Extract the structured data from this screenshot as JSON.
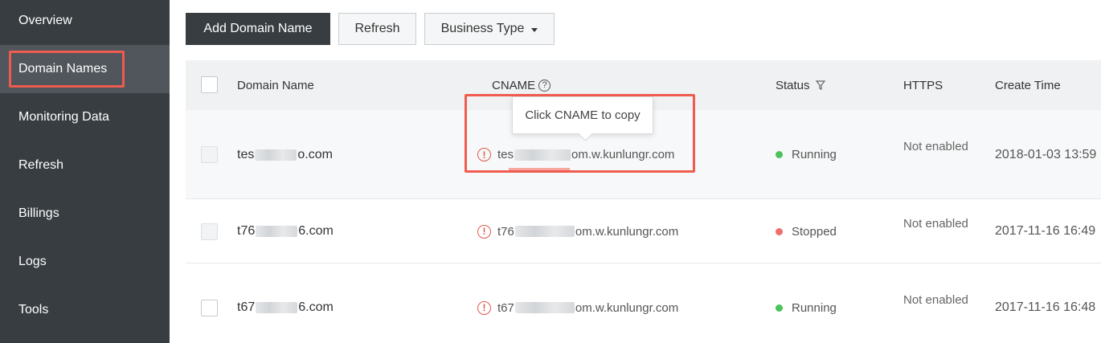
{
  "sidebar": {
    "items": [
      {
        "label": "Overview"
      },
      {
        "label": "Domain Names"
      },
      {
        "label": "Monitoring Data"
      },
      {
        "label": "Refresh"
      },
      {
        "label": "Billings"
      },
      {
        "label": "Logs"
      },
      {
        "label": "Tools"
      }
    ],
    "active": "Domain Names"
  },
  "toolbar": {
    "add_label": "Add Domain Name",
    "refresh_label": "Refresh",
    "business_type_label": "Business Type"
  },
  "table": {
    "headers": {
      "domain": "Domain Name",
      "cname": "CNAME",
      "status": "Status",
      "https": "HTTPS",
      "create_time": "Create Time"
    },
    "tooltip": "Click CNAME to copy",
    "rows": [
      {
        "domain_prefix": "tes",
        "domain_suffix": "o.com",
        "cname_prefix": "tes",
        "cname_suffix": "om.w.kunlungr.com",
        "status": "Running",
        "https": "Not enabled",
        "create_time": "2018-01-03 13:59"
      },
      {
        "domain_prefix": "t76",
        "domain_suffix": "6.com",
        "cname_prefix": "t76",
        "cname_suffix": "om.w.kunlungr.com",
        "status": "Stopped",
        "https": "Not enabled",
        "create_time": "2017-11-16 16:49"
      },
      {
        "domain_prefix": "t67",
        "domain_suffix": "6.com",
        "cname_prefix": "t67",
        "cname_suffix": "om.w.kunlungr.com",
        "status": "Running",
        "https": "Not enabled",
        "create_time": "2017-11-16 16:48"
      }
    ]
  },
  "colors": {
    "sidebar_bg": "#373d41",
    "highlight": "#f05b4f",
    "running": "#4cc25a",
    "stopped": "#f06e6e"
  },
  "icons": {
    "warning": "exclamation-circle-icon",
    "help": "question-circle-icon",
    "filter": "filter-icon",
    "caret": "caret-down-icon"
  }
}
